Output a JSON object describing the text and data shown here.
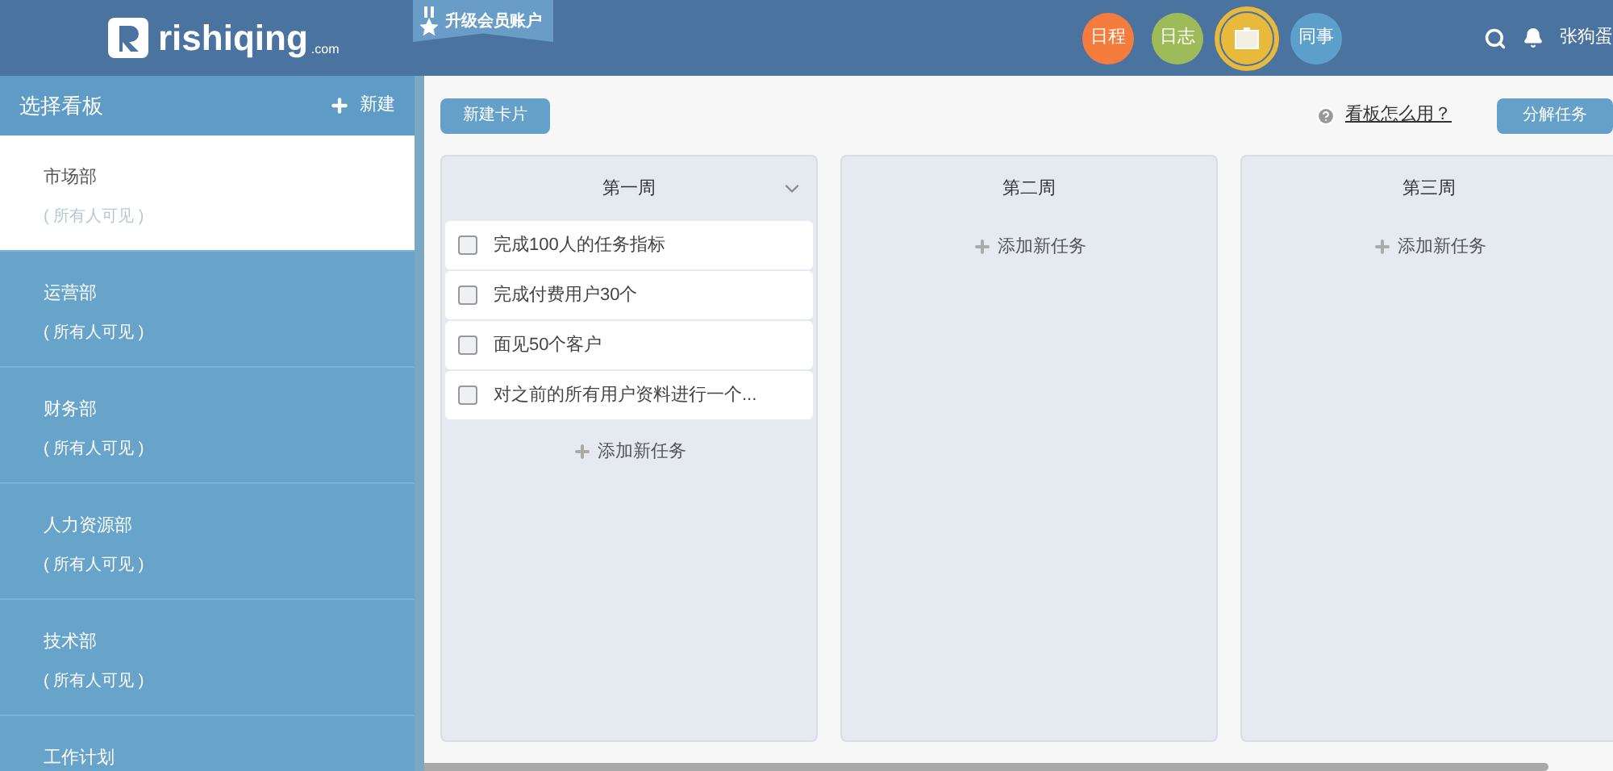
{
  "header": {
    "logo": {
      "name": "rishiqing",
      "suffix": ".com"
    },
    "upgrade_badge": "升级会员账户",
    "nav": [
      {
        "kind": "text",
        "label": "日程",
        "color": "#f47c3c",
        "selected": false
      },
      {
        "kind": "text",
        "label": "日志",
        "color": "#9ebb5a",
        "selected": false
      },
      {
        "kind": "board",
        "color": "#e8b93a",
        "selected": true
      },
      {
        "kind": "text",
        "label": "同事",
        "color": "#5d9fcb",
        "selected": false
      }
    ],
    "user": "张狗蛋"
  },
  "sidebar": {
    "title": "选择看板",
    "new_label": "新建",
    "items": [
      {
        "name": "市场部",
        "visibility": "( 所有人可见 )",
        "selected": true
      },
      {
        "name": "运营部",
        "visibility": "( 所有人可见 )",
        "selected": false
      },
      {
        "name": "财务部",
        "visibility": "( 所有人可见 )",
        "selected": false
      },
      {
        "name": "人力资源部",
        "visibility": "( 所有人可见 )",
        "selected": false
      },
      {
        "name": "技术部",
        "visibility": "( 所有人可见 )",
        "selected": false
      },
      {
        "name": "工作计划",
        "selected": false
      }
    ]
  },
  "toolbar": {
    "new_card": "新建卡片",
    "help_link": "看板怎么用？",
    "split_task": "分解任务"
  },
  "columns": [
    {
      "title": "第一周",
      "expanded": true,
      "tasks": [
        {
          "text": "完成100人的任务指标",
          "checked": false
        },
        {
          "text": "完成付费用户30个",
          "checked": false
        },
        {
          "text": "面见50个客户",
          "checked": false
        },
        {
          "text": "对之前的所有用户资料进行一个...",
          "checked": false
        }
      ],
      "add_label": "添加新任务"
    },
    {
      "title": "第二周",
      "add_label": "添加新任务"
    },
    {
      "title": "第三周",
      "add_label": "添加新任务"
    }
  ]
}
